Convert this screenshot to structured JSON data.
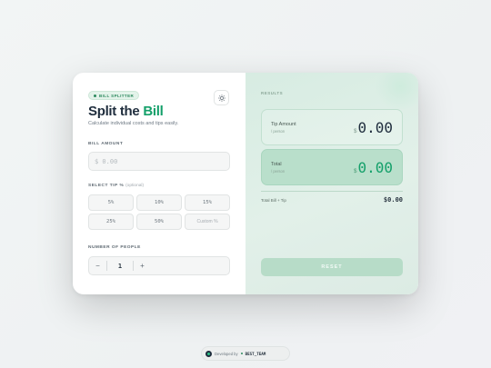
{
  "app": {
    "badge": "BILL SPLITTER",
    "title_main": "Split the ",
    "title_accent": "Bill",
    "subtitle": "Calculate individual costs and tips easily.",
    "accent_color": "#14a06a",
    "theme_icon": "sun-icon"
  },
  "bill": {
    "label": "BILL AMOUNT",
    "placeholder": "$ 0.00"
  },
  "tip": {
    "label": "SELECT TIP %",
    "optional": "(optional)",
    "options": [
      "5%",
      "10%",
      "15%",
      "25%",
      "50%"
    ],
    "custom_placeholder": "Custom %"
  },
  "people": {
    "label": "NUMBER OF PEOPLE",
    "value": "1",
    "decrement": "−",
    "increment": "+"
  },
  "results": {
    "label": "RESULTS",
    "tip_amount": {
      "name": "Tip Amount",
      "sub": "/ person",
      "currency": "$",
      "value": "0.00"
    },
    "total": {
      "name": "Total",
      "sub": "/ person",
      "currency": "$",
      "value": "0.00"
    },
    "summary_label": "Total Bill + Tip",
    "summary_value": "$0.00",
    "reset": "RESET"
  },
  "footer": {
    "prefix": "Developed by",
    "handle": "BEST_TEAM"
  }
}
